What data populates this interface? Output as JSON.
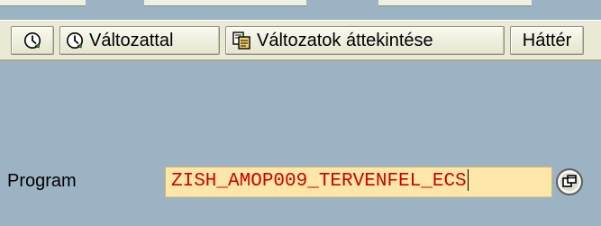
{
  "toolbar": {
    "execute_icon": "execute-clock-icon",
    "execute_with_variant_icon": "execute-clock-icon",
    "with_variant_label": "Változattal",
    "variants_overview_icon": "copy-pages-icon",
    "variants_overview_label": "Változatok áttekintése",
    "background_label": "Háttér"
  },
  "form": {
    "program_label": "Program",
    "program_value": "ZISH_AMOP009_TERVENFEL_ECS",
    "value_help_icon": "value-help-icon"
  },
  "colors": {
    "background": "#9bb3c3",
    "toolbar": "#e9e9d6",
    "input_bg": "#fde7a8",
    "input_text": "#cc0000"
  }
}
